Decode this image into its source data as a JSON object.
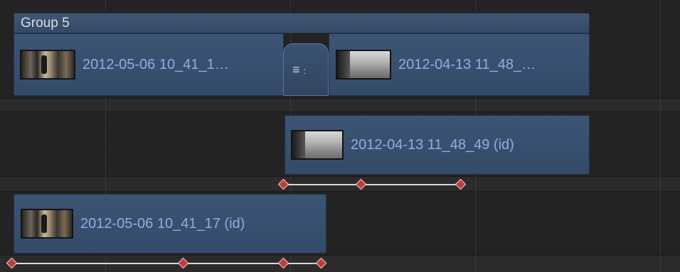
{
  "group": {
    "title": "Group 5"
  },
  "lanes": {
    "group_clip_a": {
      "label": "2012-05-06 10_41_1…",
      "thumbnail": "room-scene"
    },
    "group_clip_b": {
      "label": "2012-04-13 11_48_…",
      "thumbnail": "wall-scene"
    },
    "transition": {
      "icon": "transition-menu-icon",
      "glyph": "≡",
      "extra": ":"
    },
    "clip_mid": {
      "label": "2012-04-13 11_48_49 (id)",
      "thumbnail": "wall-scene"
    },
    "clip_low": {
      "label": "2012-05-06 10_41_17 (id)",
      "thumbnail": "room-scene"
    }
  },
  "keyframe_rows": {
    "mid": {
      "count": 3,
      "color": "#c23b3b"
    },
    "low": {
      "count": 4,
      "color": "#c23b3b"
    }
  },
  "colors": {
    "clip": "#3c5575",
    "label": "#8eaee0",
    "background": "#232323",
    "keyframe": "#c23b3b"
  }
}
